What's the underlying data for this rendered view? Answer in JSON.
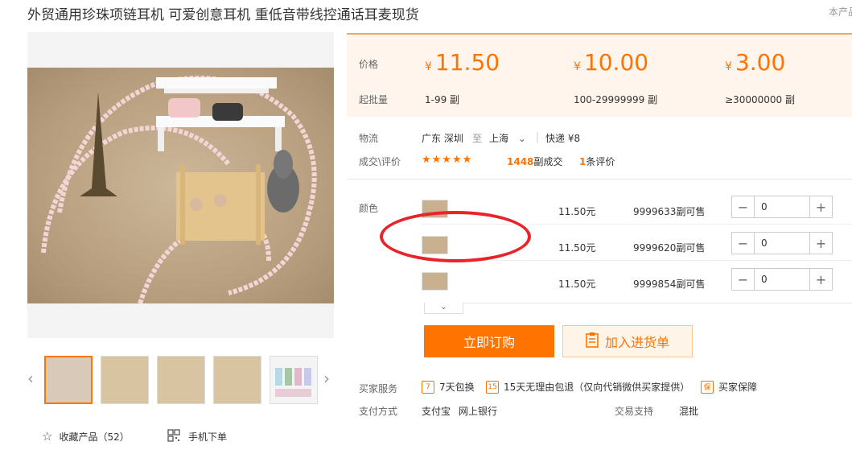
{
  "title": "外贸通用珍珠项链耳机 可爱创意耳机 重低音带线控通话耳麦现货",
  "corner_note": "本产品",
  "price": {
    "label": "价格",
    "moq_label": "起批量",
    "currency": "¥",
    "tiers": [
      {
        "price": "11.50",
        "moq": "1-99 副"
      },
      {
        "price": "10.00",
        "moq": "100-29999999 副"
      },
      {
        "price": "3.00",
        "moq": "≥30000000 副"
      }
    ]
  },
  "logistics": {
    "label": "物流",
    "origin": "广东 深圳",
    "to": "至",
    "destination": "上海",
    "method": "快递 ¥8"
  },
  "deals": {
    "label": "成交\\评价",
    "stars": "★★★★★",
    "count": "1448",
    "count_suffix": "副成交",
    "reviews": "1",
    "reviews_suffix": "条评价"
  },
  "sku": {
    "label": "颜色",
    "rows": [
      {
        "price": "11.50元",
        "stock": "9999633副可售",
        "qty": "0"
      },
      {
        "price": "11.50元",
        "stock": "9999620副可售",
        "qty": "0"
      },
      {
        "price": "11.50元",
        "stock": "9999854副可售",
        "qty": "0"
      }
    ],
    "expand": "⌄"
  },
  "buttons": {
    "order": "立即订购",
    "cart": "加入进货单"
  },
  "services": {
    "label": "买家服务",
    "items": [
      {
        "icon": "return-7day-icon",
        "glyph": "7",
        "text": "7天包换"
      },
      {
        "icon": "return-15day-icon",
        "glyph": "15",
        "text": "15天无理由包退（仅向代销微供买家提供）"
      },
      {
        "icon": "buyer-protection-icon",
        "glyph": "保",
        "text": "买家保障"
      }
    ]
  },
  "payment": {
    "label": "支付方式",
    "methods": "支付宝",
    "bank": "网上银行",
    "trade_label": "交易支持",
    "trade_value": "混批"
  },
  "favorite": {
    "label": "收藏产品（52）"
  },
  "mobile": {
    "label": "手机下单"
  },
  "colors": {
    "accent": "#ff7300",
    "annotation": "#e8232a"
  }
}
